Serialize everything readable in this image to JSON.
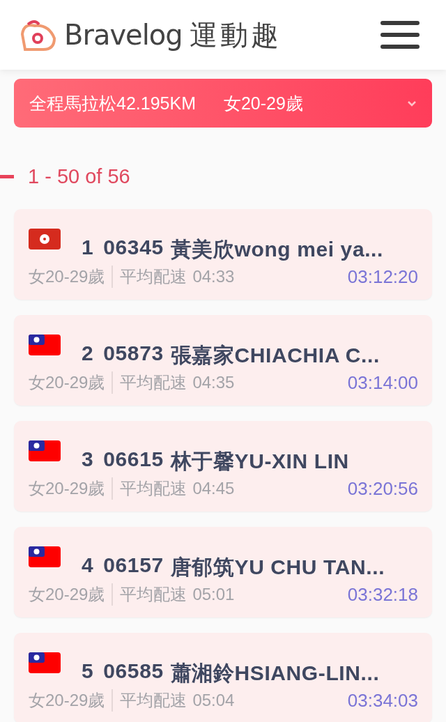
{
  "header": {
    "brand": "Bravelog",
    "brand_cjk": "運動趣"
  },
  "filter": {
    "race": "全程馬拉松42.195KM",
    "group": "女20-29歲"
  },
  "count": "1 - 50 of 56",
  "results": [
    {
      "kind": "hk",
      "rank": "1",
      "bib": "06345",
      "name": "黃美欣wong mei ya...",
      "group": "女20-29歲",
      "pace_label": "平均配速",
      "pace": "04:33",
      "time": "03:12:20"
    },
    {
      "kind": "tw",
      "rank": "2",
      "bib": "05873",
      "name": "張嘉家CHIACHIA C...",
      "group": "女20-29歲",
      "pace_label": "平均配速",
      "pace": "04:35",
      "time": "03:14:00"
    },
    {
      "kind": "tw",
      "rank": "3",
      "bib": "06615",
      "name": "林于馨YU-XIN LIN",
      "group": "女20-29歲",
      "pace_label": "平均配速",
      "pace": "04:45",
      "time": "03:20:56"
    },
    {
      "kind": "tw",
      "rank": "4",
      "bib": "06157",
      "name": "唐郁筑YU CHU TAN...",
      "group": "女20-29歲",
      "pace_label": "平均配速",
      "pace": "05:01",
      "time": "03:32:18"
    },
    {
      "kind": "tw",
      "rank": "5",
      "bib": "06585",
      "name": "蕭湘鈴HSIANG-LIN...",
      "group": "女20-29歲",
      "pace_label": "平均配速",
      "pace": "05:04",
      "time": "03:34:03"
    }
  ]
}
